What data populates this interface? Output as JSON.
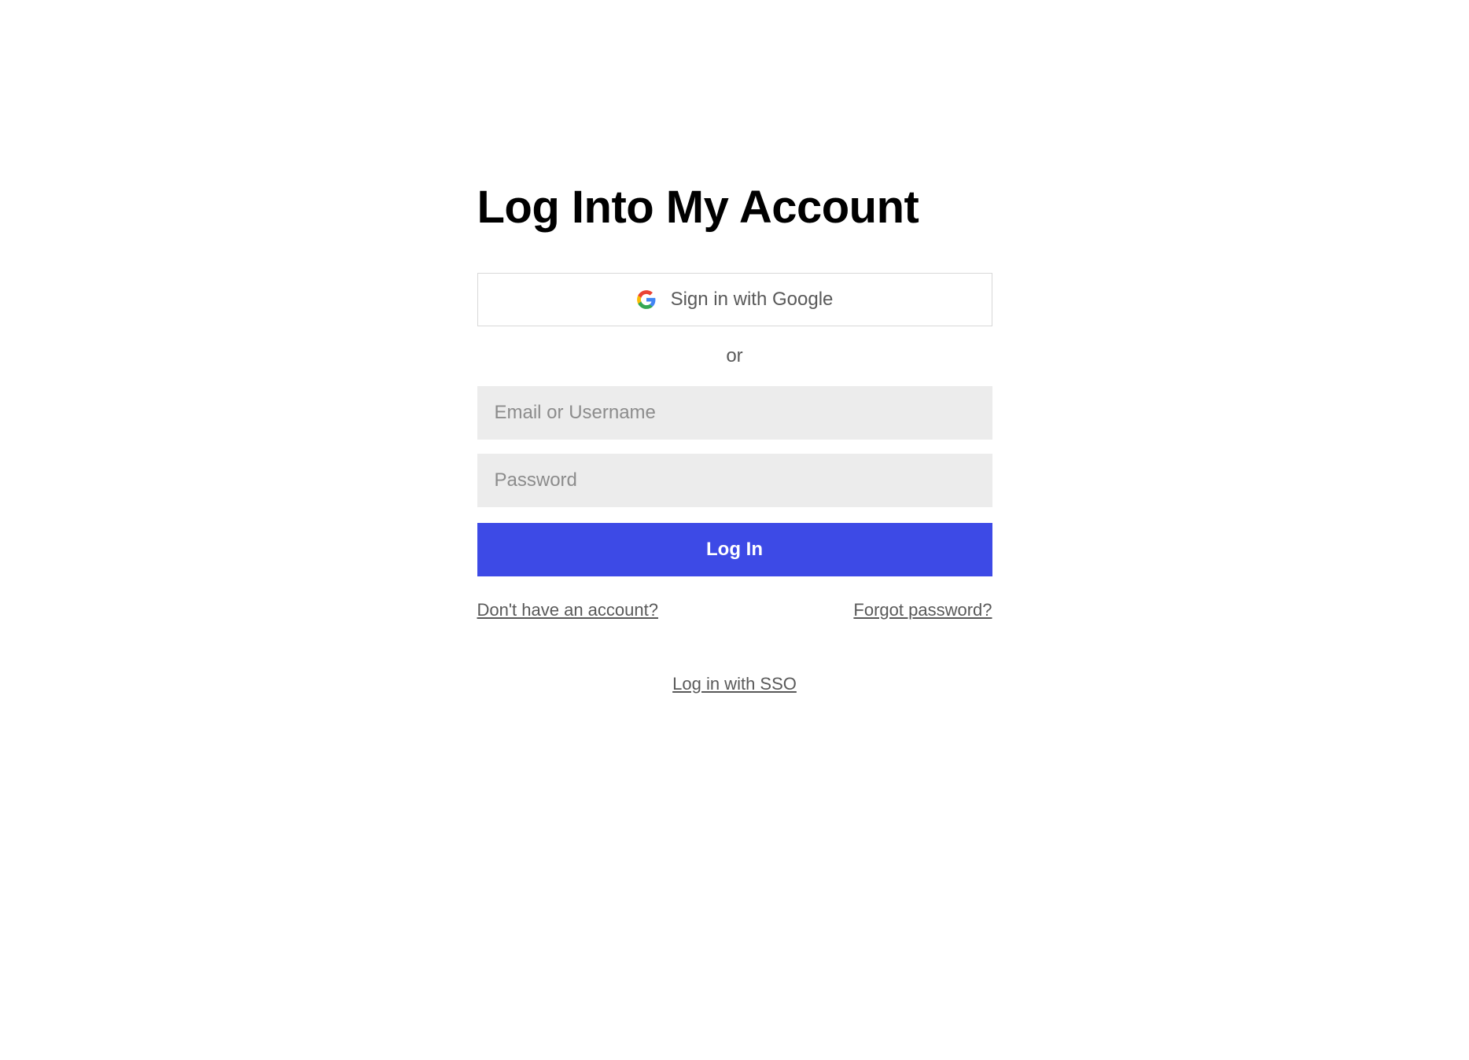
{
  "login": {
    "title": "Log Into My Account",
    "google_button_label": "Sign in with Google",
    "or_text": "or",
    "email_placeholder": "Email or Username",
    "password_placeholder": "Password",
    "login_button_label": "Log In",
    "signup_link": "Don't have an account?",
    "forgot_password_link": "Forgot password?",
    "sso_link": "Log in with SSO"
  }
}
